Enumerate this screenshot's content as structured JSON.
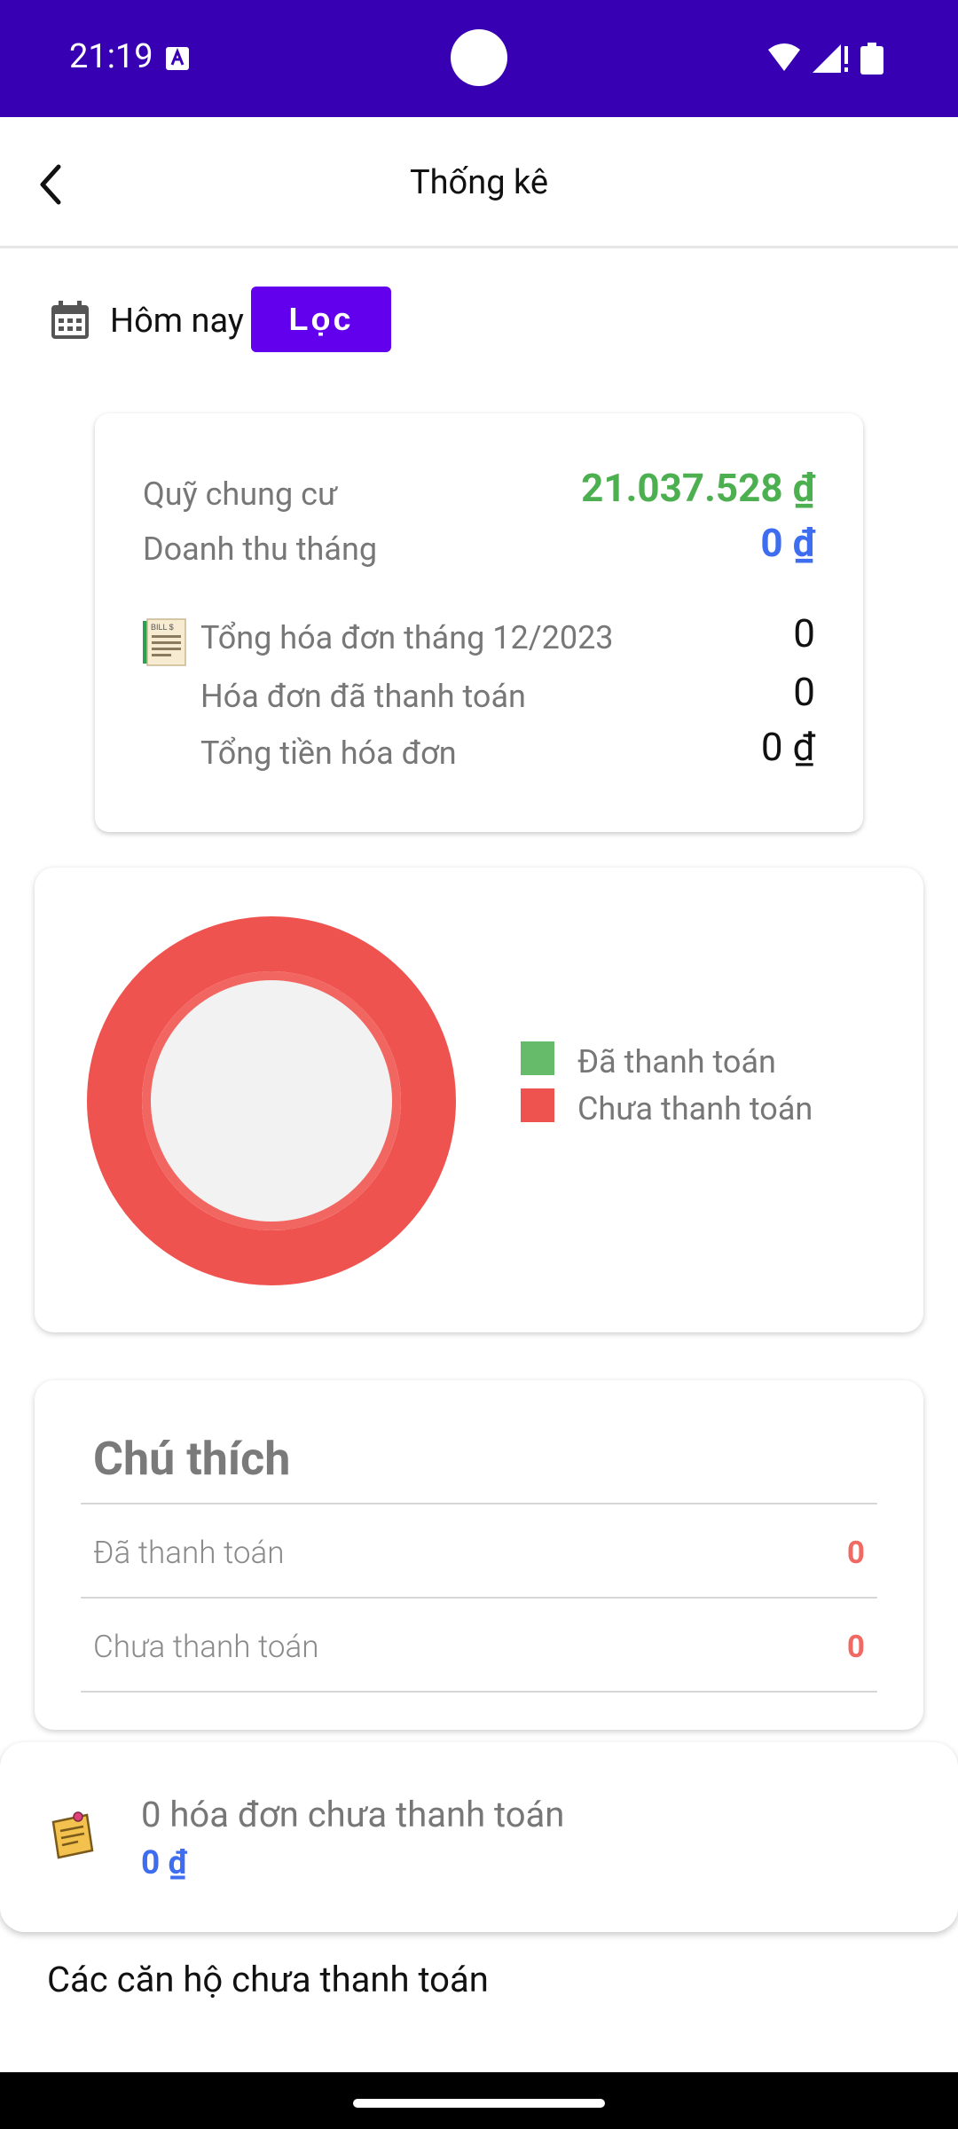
{
  "status_bar": {
    "time": "21:19",
    "icons": [
      "a-notification-icon",
      "wifi-icon",
      "signal-icon",
      "battery-icon"
    ]
  },
  "app_bar": {
    "title": "Thống kê",
    "back_icon": "arrow-back-icon"
  },
  "filter": {
    "label": "Hôm nay",
    "button_label": "Lọc",
    "icon": "calendar-icon"
  },
  "summary": {
    "fund_label": "Quỹ chung cư",
    "fund_value": "21.037.528",
    "revenue_label": "Doanh thu tháng",
    "revenue_value": "0",
    "currency_symbol": "₫",
    "total_bills_label": "Tổng hóa đơn tháng 12/2023",
    "total_bills_value": "0",
    "paid_bills_label": "Hóa đơn đã thanh toán",
    "paid_bills_value": "0",
    "total_amount_label": "Tổng tiền hóa đơn",
    "total_amount_value": "0"
  },
  "chart_data": {
    "type": "pie",
    "categories": [
      "Đã thanh toán",
      "Chưa thanh toán"
    ],
    "values": [
      0,
      0
    ],
    "colors": [
      "#66bb6a",
      "#ef5350"
    ],
    "legend_position": "right"
  },
  "legend": {
    "paid_label": "Đã thanh toán",
    "unpaid_label": "Chưa thanh toán"
  },
  "notes": {
    "title": "Chú thích",
    "rows": [
      {
        "label": "Đã thanh toán",
        "value": "0"
      },
      {
        "label": "Chưa thanh toán",
        "value": "0"
      }
    ]
  },
  "unpaid": {
    "count_text": "0 hóa đơn chưa thanh toán",
    "amount": "0",
    "icon": "sticky-note-icon"
  },
  "section": {
    "heading": "Các căn hộ chưa thanh toán"
  },
  "colors": {
    "status_bar": "#3700b3",
    "accent": "#6200ee",
    "green": "#4caf50",
    "blue": "#3f6df0",
    "red": "#ef5350"
  }
}
